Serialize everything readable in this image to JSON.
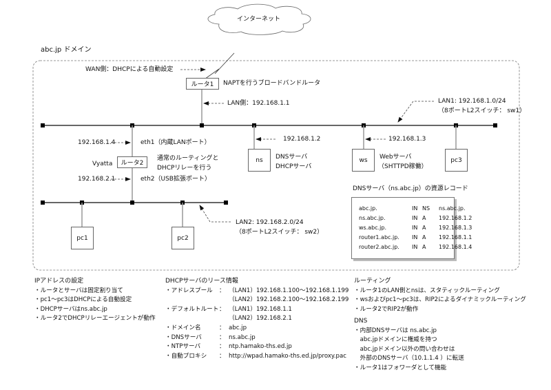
{
  "internet_label": "インターネット",
  "domain_label": "abc.jp ドメイン",
  "wan_label": "WAN側：DHCPによる自動設定",
  "router1": {
    "name": "ルータ1",
    "desc": "NAPTを行うブロードバンドルータ",
    "lan_label": "LAN側：192.168.1.1"
  },
  "lan1": {
    "label": "LAN1: 192.168.1.0/24",
    "switch": "（8ポートL2スイッチ： sw1）"
  },
  "router2": {
    "name": "ルータ2",
    "os": "Vyatta",
    "desc_line1": "通常のルーティングと",
    "desc_line2": "DHCPリレーを行う",
    "eth1_ip": "192.168.1.4",
    "eth1_label": "eth1（内蔵LANポート）",
    "eth2_ip": "192.168.2.1",
    "eth2_label": "eth2（USB拡張ポート）"
  },
  "ns": {
    "name": "ns",
    "ip": "192.168.1.2",
    "desc_line1": "DNSサーバ",
    "desc_line2": "DHCPサーバ"
  },
  "ws": {
    "name": "ws",
    "ip": "192.168.1.3",
    "desc_line1": "Webサーバ",
    "desc_line2": "（SHTTPD稼働）"
  },
  "pc3": {
    "name": "pc3"
  },
  "pc1": {
    "name": "pc1"
  },
  "pc2": {
    "name": "pc2"
  },
  "lan2": {
    "label": "LAN2: 192.168.2.0/24",
    "switch": "（8ポートL2スイッチ： sw2）"
  },
  "dns_records": {
    "title": "DNSサーバ（ns.abc.jp）の資源レコード",
    "rows": [
      {
        "name": "abc.jp.",
        "class": "IN",
        "type": "NS",
        "value": "ns.abc.jp."
      },
      {
        "name": "ns.abc.jp.",
        "class": "IN",
        "type": "A",
        "value": "192.168.1.2"
      },
      {
        "name": "ws.abc.jp.",
        "class": "IN",
        "type": "A",
        "value": "192.168.1.3"
      },
      {
        "name": "router1.abc.jp.",
        "class": "IN",
        "type": "A",
        "value": "192.168.1.1"
      },
      {
        "name": "router2.abc.jp.",
        "class": "IN",
        "type": "A",
        "value": "192.168.1.4"
      }
    ]
  },
  "ip_settings": {
    "title": "IPアドレスの設定",
    "items": [
      "・ルータとサーバは固定割り当て",
      "・pc1～pc3はDHCPによる自動設定",
      "・DHCPサーバはns.abc.jp",
      "・ルータ2でDHCPリレーエージェントが動作"
    ]
  },
  "dhcp_lease": {
    "title": "DHCPサーバのリース情報",
    "rows": [
      {
        "key": "・アドレスプール",
        "sep": "：",
        "value": "（LAN1）192.168.1.100～192.168.1.199"
      },
      {
        "key": "",
        "sep": "",
        "value": "（LAN2）192.168.2.100～192.168.2.199"
      },
      {
        "key": "・デフォルトルート",
        "sep": "：",
        "value": "（LAN1）192.168.1.1"
      },
      {
        "key": "",
        "sep": "",
        "value": "（LAN2）192.168.2.1"
      },
      {
        "key": "・ドメイン名",
        "sep": "：",
        "value": "abc.jp"
      },
      {
        "key": "・DNSサーバ",
        "sep": "：",
        "value": "ns.abc.jp"
      },
      {
        "key": "・NTPサーバ",
        "sep": "：",
        "value": "ntp.hamako-ths.ed.jp"
      },
      {
        "key": "・自動プロキシ",
        "sep": "：",
        "value": "http://wpad.hamako-ths.ed.jp/proxy.pac"
      }
    ]
  },
  "routing": {
    "title": "ルーティング",
    "items": [
      "・ルータ1のLAN側とnsは、スタティックルーティング",
      "・wsおよびpc1～pc3は、RIP2によるダイナミックルーティング",
      "・ルータ2でRIP2が動作"
    ]
  },
  "dns": {
    "title": "DNS",
    "items": [
      "・内部DNSサーバは ns.abc.jp",
      "　abc.jpドメインに権威を持つ",
      "　abc.jpドメイン以外の問い合わせは",
      "　外部のDNSサーバ（10.1.1.4 ）に転送",
      "・ルータ1はフォワーダとして機能"
    ]
  }
}
